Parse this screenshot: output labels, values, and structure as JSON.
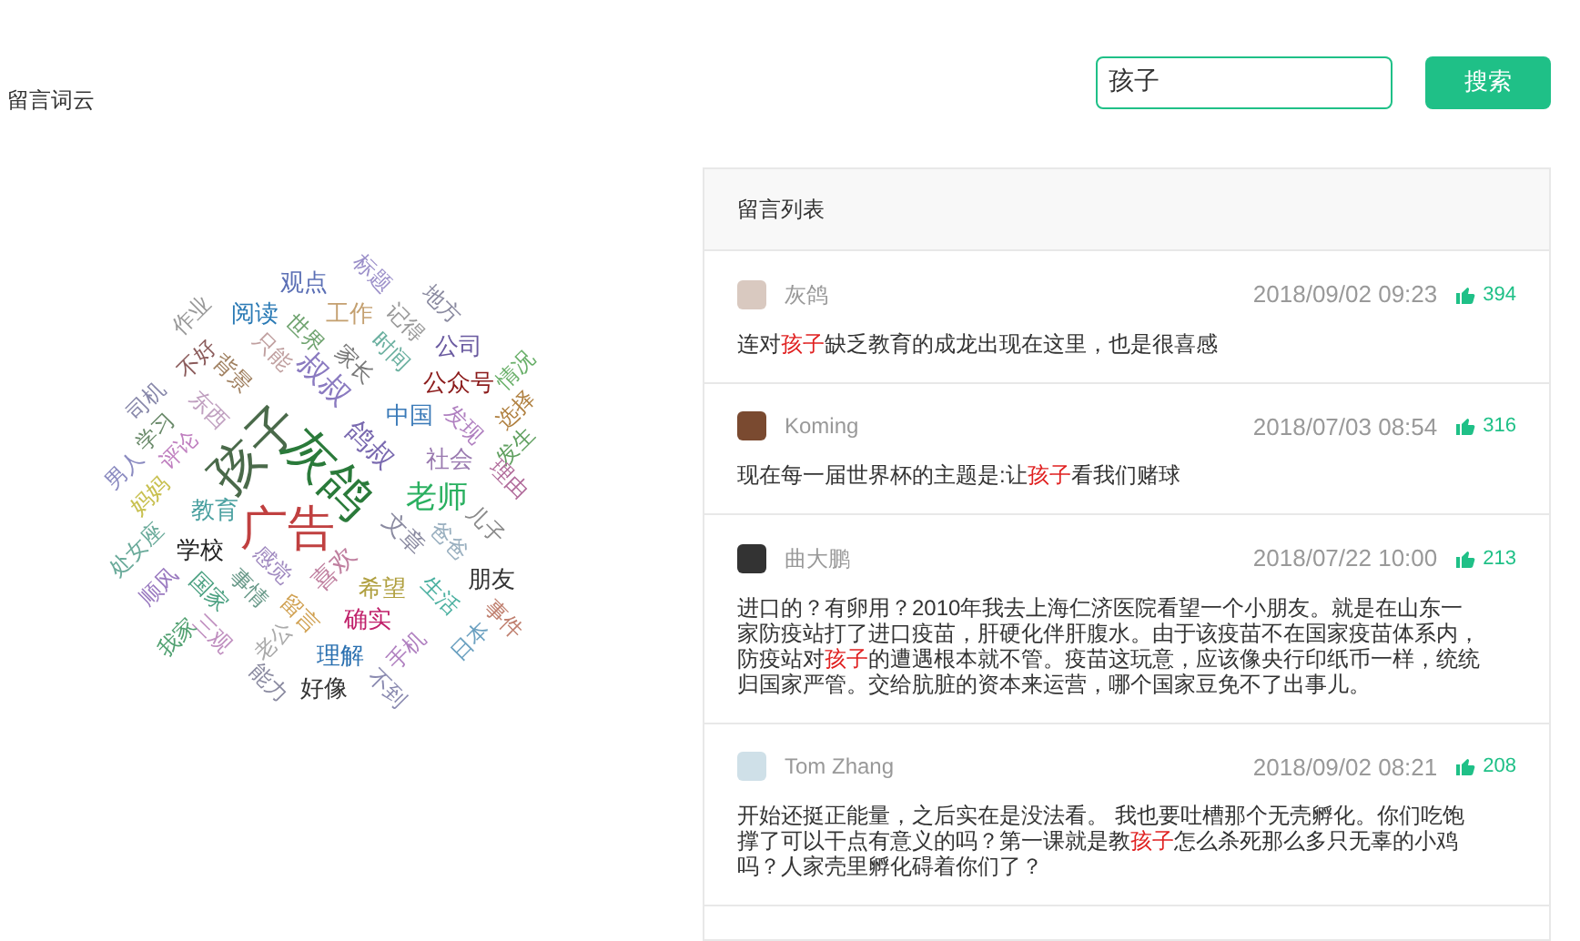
{
  "title": "留言词云",
  "word_cloud": [
    {
      "text": "观点",
      "color": "#5b6fb5"
    },
    {
      "text": "标题",
      "color": "#9b8fc9"
    },
    {
      "text": "地方",
      "color": "#8a8aa0"
    },
    {
      "text": "工作",
      "color": "#c4a070"
    },
    {
      "text": "阅读",
      "color": "#2a7ab5"
    },
    {
      "text": "作业",
      "color": "#999999"
    },
    {
      "text": "世界",
      "color": "#6fa36f"
    },
    {
      "text": "记得",
      "color": "#999999"
    },
    {
      "text": "公司",
      "color": "#6a5aa0"
    },
    {
      "text": "情况",
      "color": "#6ab06a"
    },
    {
      "text": "不好",
      "color": "#8a5a5a"
    },
    {
      "text": "只能",
      "color": "#c0a0a0"
    },
    {
      "text": "家长",
      "color": "#777777"
    },
    {
      "text": "时间",
      "color": "#6bb0a0"
    },
    {
      "text": "背景",
      "color": "#a08060"
    },
    {
      "text": "公众号",
      "color": "#8b1a1a"
    },
    {
      "text": "司机",
      "color": "#8888aa"
    },
    {
      "text": "叔叔",
      "color": "#8a7ac0"
    },
    {
      "text": "选择",
      "color": "#b08040"
    },
    {
      "text": "东西",
      "color": "#c0a0c0"
    },
    {
      "text": "中国",
      "color": "#3a7ab8"
    },
    {
      "text": "发现",
      "color": "#b080c0"
    },
    {
      "text": "学习",
      "color": "#6a8a6a"
    },
    {
      "text": "鸽叔",
      "color": "#7a6ab0"
    },
    {
      "text": "发生",
      "color": "#60a060"
    },
    {
      "text": "评论",
      "color": "#c080c0"
    },
    {
      "text": "孩子",
      "color": "#4a6a4a"
    },
    {
      "text": "灰鸽",
      "color": "#2a7a3a"
    },
    {
      "text": "社会",
      "color": "#9a7ab0"
    },
    {
      "text": "理由",
      "color": "#b06a9a"
    },
    {
      "text": "男人",
      "color": "#8a8ac0"
    },
    {
      "text": "妈妈",
      "color": "#c8c050"
    },
    {
      "text": "老师",
      "color": "#2ab060"
    },
    {
      "text": "教育",
      "color": "#4aa0a0"
    },
    {
      "text": "广告",
      "color": "#c04040"
    },
    {
      "text": "儿子",
      "color": "#8a8a8a"
    },
    {
      "text": "文章",
      "color": "#8a8aa0"
    },
    {
      "text": "爸爸",
      "color": "#9ab0c0"
    },
    {
      "text": "处女座",
      "color": "#6aaa9a"
    },
    {
      "text": "学校",
      "color": "#222222"
    },
    {
      "text": "感觉",
      "color": "#a08ac0"
    },
    {
      "text": "喜欢",
      "color": "#c080a0"
    },
    {
      "text": "朋友",
      "color": "#333333"
    },
    {
      "text": "希望",
      "color": "#b0a040"
    },
    {
      "text": "顺风",
      "color": "#9a7ac0"
    },
    {
      "text": "国家",
      "color": "#4aa080"
    },
    {
      "text": "事情",
      "color": "#6a9a8a"
    },
    {
      "text": "生活",
      "color": "#4ab0a0"
    },
    {
      "text": "事件",
      "color": "#c08070"
    },
    {
      "text": "确实",
      "color": "#c0206a"
    },
    {
      "text": "留言",
      "color": "#d0a050"
    },
    {
      "text": "三观",
      "color": "#c090c0"
    },
    {
      "text": "老公",
      "color": "#aaaaaa"
    },
    {
      "text": "手机",
      "color": "#b080c0"
    },
    {
      "text": "日本",
      "color": "#6aa0c0"
    },
    {
      "text": "我家",
      "color": "#50a070"
    },
    {
      "text": "理解",
      "color": "#2a70b0"
    },
    {
      "text": "能力",
      "color": "#8a8aa0"
    },
    {
      "text": "好像",
      "color": "#333333"
    },
    {
      "text": "不到",
      "color": "#8a8ab0"
    }
  ],
  "search": {
    "value": "孩子",
    "button": "搜索"
  },
  "list": {
    "title": "留言列表",
    "comments": [
      {
        "name": "灰鸽",
        "date": "2018/09/02 09:23",
        "likes": "394",
        "parts": [
          {
            "text": "连对",
            "highlight": false
          },
          {
            "text": "孩子",
            "highlight": true
          },
          {
            "text": "缺乏教育的成龙出现在这里，也是很喜感",
            "highlight": false
          }
        ]
      },
      {
        "name": "Koming",
        "date": "2018/07/03 08:54",
        "likes": "316",
        "parts": [
          {
            "text": "现在每一届世界杯的主题是:让",
            "highlight": false
          },
          {
            "text": "孩子",
            "highlight": true
          },
          {
            "text": "看我们赌球",
            "highlight": false
          }
        ]
      },
      {
        "name": "曲大鹏",
        "date": "2018/07/22 10:00",
        "likes": "213",
        "parts": [
          {
            "text": "进口的？有卵用？2010年我去上海仁济医院看望一个小朋友。就是在山东一家防疫站打了进口疫苗，肝硬化伴肝腹水。由于该疫苗不在国家疫苗体系内，防疫站对",
            "highlight": false
          },
          {
            "text": "孩子",
            "highlight": true
          },
          {
            "text": "的遭遇根本就不管。疫苗这玩意，应该像央行印纸币一样，统统归国家严管。交给肮脏的资本来运营，哪个国家豆免不了出事儿。",
            "highlight": false
          }
        ]
      },
      {
        "name": "Tom Zhang",
        "date": "2018/09/02 08:21",
        "likes": "208",
        "parts": [
          {
            "text": "开始还挺正能量，之后实在是没法看。 我也要吐槽那个无壳孵化。你们吃饱撑了可以干点有意义的吗？第一课就是教",
            "highlight": false
          },
          {
            "text": "孩子",
            "highlight": true
          },
          {
            "text": "怎么杀死那么多只无辜的小鸡吗？人家壳里孵化碍着你们了？",
            "highlight": false
          }
        ]
      }
    ]
  }
}
